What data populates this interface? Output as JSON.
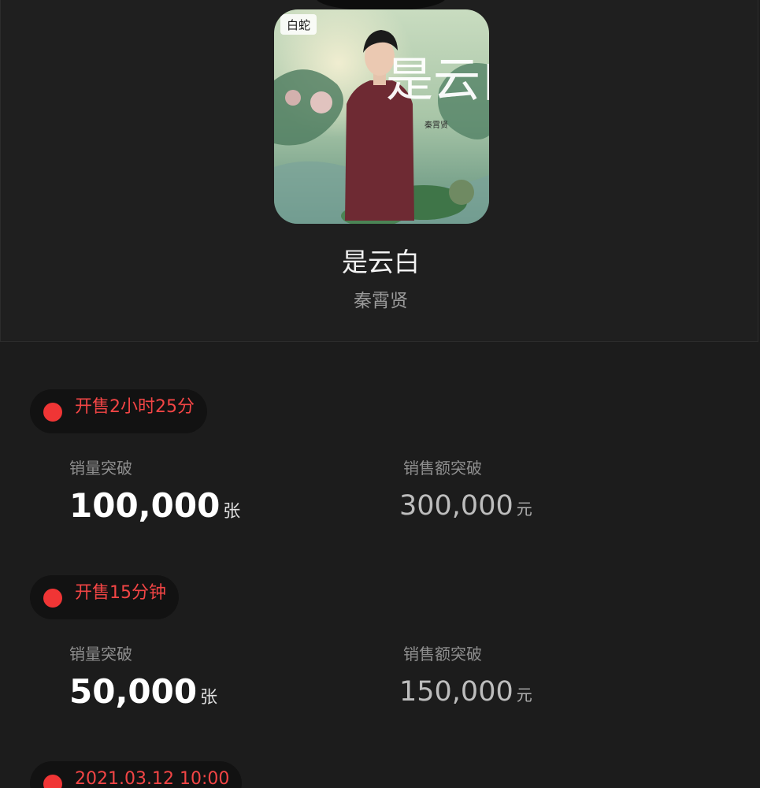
{
  "song": {
    "title": "是云白",
    "artist": "秦霄贤",
    "cover_title_art": "是云白",
    "cover_credit": "秦霄贤",
    "cover_logo": "白蛇"
  },
  "milestones": [
    {
      "time": "开售2小时25分",
      "sales_label": "销量突破",
      "sales_value": "100,000",
      "sales_unit": "张",
      "revenue_label": "销售额突破",
      "revenue_value": "300,000",
      "revenue_unit": "元"
    },
    {
      "time": "开售15分钟",
      "sales_label": "销量突破",
      "sales_value": "50,000",
      "sales_unit": "张",
      "revenue_label": "销售额突破",
      "revenue_value": "150,000",
      "revenue_unit": "元"
    },
    {
      "time": "2021.03.12 10:00"
    }
  ],
  "colors": {
    "background": "#1c1c1c",
    "accent_red": "#f03535",
    "badge_bg": "#121212"
  }
}
